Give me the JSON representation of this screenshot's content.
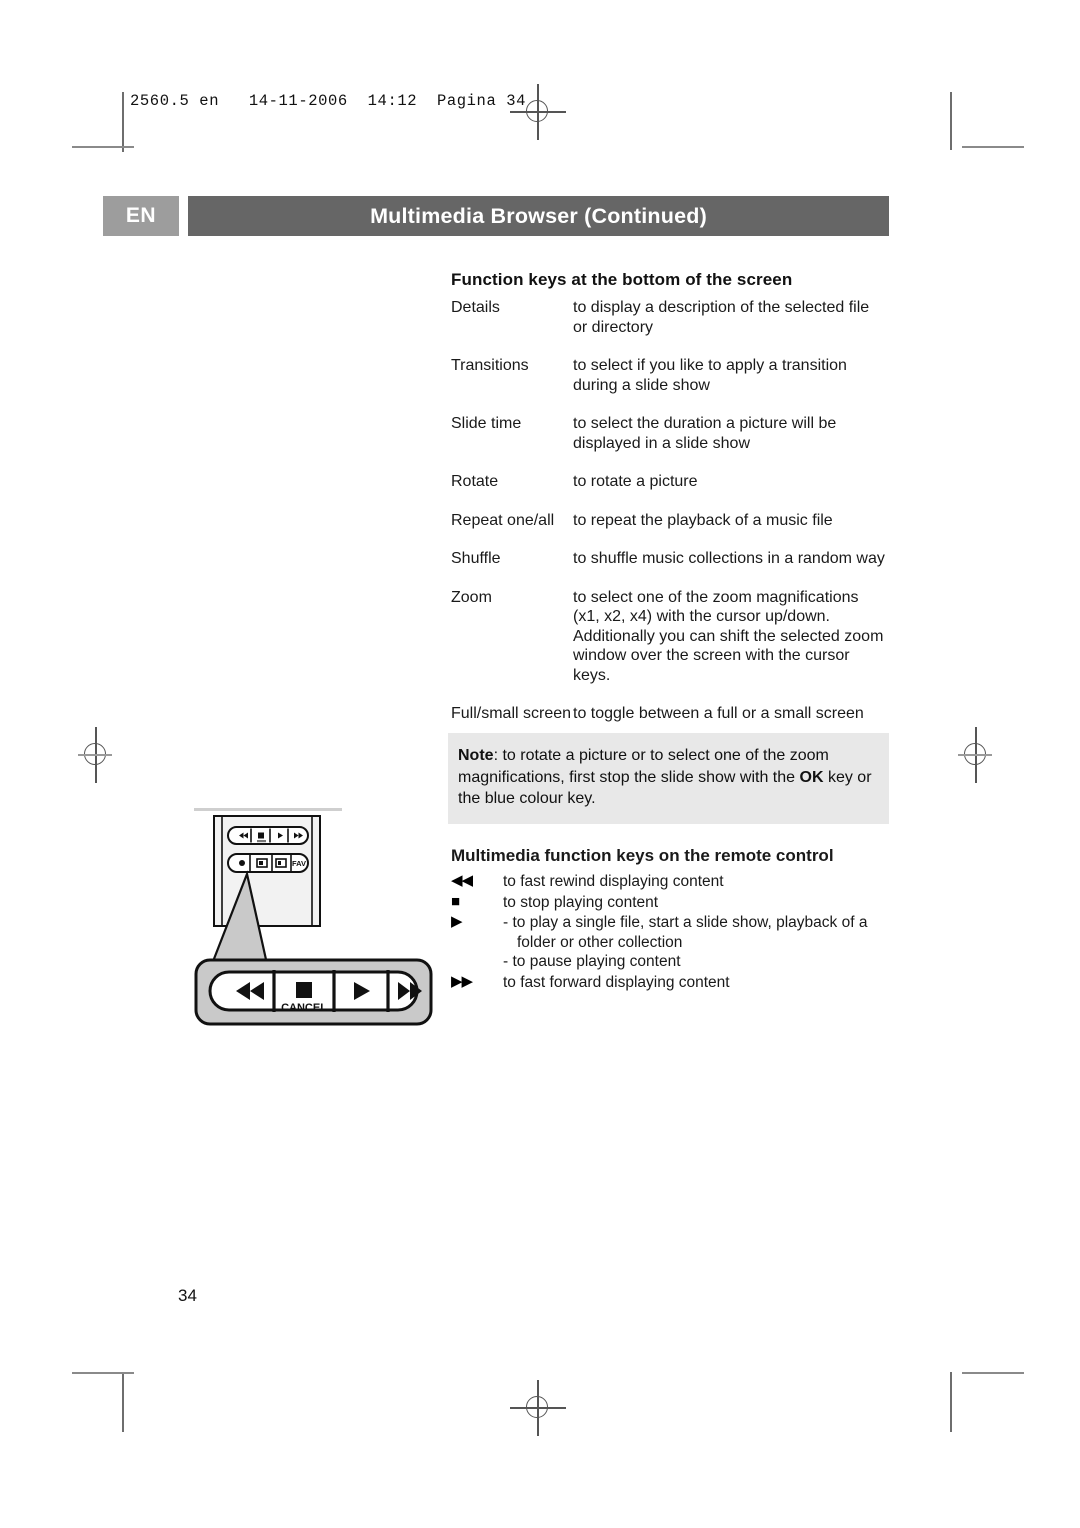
{
  "print_slug": "2560.5 en   14-11-2006  14:12  Pagina 34",
  "banner": {
    "language": "EN",
    "title": "Multimedia Browser  (Continued)",
    "lang_bg": "#9d9d9d",
    "bar_bg": "#666666"
  },
  "function_keys": {
    "heading": "Function keys at the bottom of the screen",
    "rows": [
      {
        "key": "Details",
        "lines": [
          "to display a description of the selected file",
          "or directory"
        ]
      },
      {
        "key": "Transitions",
        "lines": [
          "to select if you like to apply a transition",
          "during a slide show"
        ]
      },
      {
        "key": "Slide time",
        "lines": [
          "to select the duration a picture will be",
          "displayed in a slide show"
        ]
      },
      {
        "key": "Rotate",
        "lines": [
          "to rotate a picture"
        ]
      },
      {
        "key": "Repeat one/all",
        "lines": [
          "to repeat the playback of a music file"
        ]
      },
      {
        "key": "Shuffle",
        "lines": [
          "to shuffle music collections in a random way"
        ]
      },
      {
        "key": "Zoom",
        "lines": [
          "to select one of the zoom magnifications",
          "(x1, x2, x4) with the cursor up/down.",
          "Additionally you can shift the selected zoom",
          "window over the screen with the cursor",
          "keys."
        ]
      },
      {
        "key": "Full/small screen",
        "lines": [
          "to toggle between a full or a small screen"
        ]
      }
    ]
  },
  "note": {
    "label": "Note",
    "text_1": ": to rotate a picture or to select one of the zoom magnifications, first stop the slide show with the ",
    "ok_key": "OK",
    "text_2": " key or the blue colour key.",
    "bg": "#e8e8e8"
  },
  "remote_keys": {
    "heading": "Multimedia function keys on the remote control",
    "rows": [
      {
        "symbol": "◀◀",
        "icon_name": "fast-rewind-icon",
        "lines": [
          "to fast rewind displaying content"
        ]
      },
      {
        "symbol": "■",
        "icon_name": "stop-icon",
        "lines": [
          "to stop playing content"
        ]
      },
      {
        "symbol": "▶",
        "icon_name": "play-pause-icon",
        "lines": [
          "- to play a single file, start a slide show, playback of a",
          "folder or other collection",
          "- to pause playing content"
        ]
      },
      {
        "symbol": "▶▶",
        "icon_name": "fast-forward-icon",
        "lines": [
          "to fast forward displaying content"
        ]
      }
    ]
  },
  "remote_illustration": {
    "cancel_label": "CANCEL",
    "fav_label": "FAV",
    "body_fill": "#f2f2f2",
    "callout_fill": "#c9c9c9"
  },
  "page_number": "34"
}
